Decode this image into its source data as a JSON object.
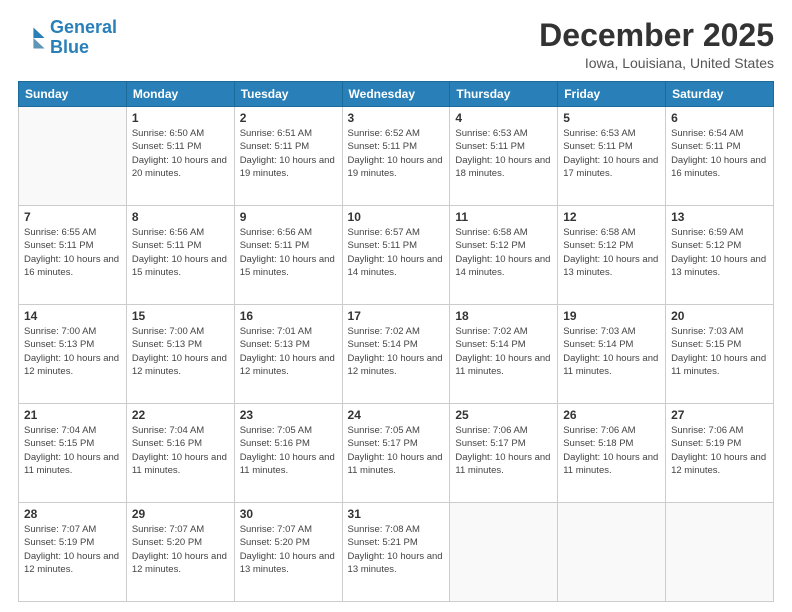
{
  "header": {
    "logo_line1": "General",
    "logo_line2": "Blue",
    "main_title": "December 2025",
    "subtitle": "Iowa, Louisiana, United States"
  },
  "calendar": {
    "weekdays": [
      "Sunday",
      "Monday",
      "Tuesday",
      "Wednesday",
      "Thursday",
      "Friday",
      "Saturday"
    ],
    "weeks": [
      [
        {
          "day": "",
          "empty": true
        },
        {
          "day": "1",
          "sunrise": "6:50 AM",
          "sunset": "5:11 PM",
          "daylight": "10 hours and 20 minutes."
        },
        {
          "day": "2",
          "sunrise": "6:51 AM",
          "sunset": "5:11 PM",
          "daylight": "10 hours and 19 minutes."
        },
        {
          "day": "3",
          "sunrise": "6:52 AM",
          "sunset": "5:11 PM",
          "daylight": "10 hours and 19 minutes."
        },
        {
          "day": "4",
          "sunrise": "6:53 AM",
          "sunset": "5:11 PM",
          "daylight": "10 hours and 18 minutes."
        },
        {
          "day": "5",
          "sunrise": "6:53 AM",
          "sunset": "5:11 PM",
          "daylight": "10 hours and 17 minutes."
        },
        {
          "day": "6",
          "sunrise": "6:54 AM",
          "sunset": "5:11 PM",
          "daylight": "10 hours and 16 minutes."
        }
      ],
      [
        {
          "day": "7",
          "sunrise": "6:55 AM",
          "sunset": "5:11 PM",
          "daylight": "10 hours and 16 minutes."
        },
        {
          "day": "8",
          "sunrise": "6:56 AM",
          "sunset": "5:11 PM",
          "daylight": "10 hours and 15 minutes."
        },
        {
          "day": "9",
          "sunrise": "6:56 AM",
          "sunset": "5:11 PM",
          "daylight": "10 hours and 15 minutes."
        },
        {
          "day": "10",
          "sunrise": "6:57 AM",
          "sunset": "5:11 PM",
          "daylight": "10 hours and 14 minutes."
        },
        {
          "day": "11",
          "sunrise": "6:58 AM",
          "sunset": "5:12 PM",
          "daylight": "10 hours and 14 minutes."
        },
        {
          "day": "12",
          "sunrise": "6:58 AM",
          "sunset": "5:12 PM",
          "daylight": "10 hours and 13 minutes."
        },
        {
          "day": "13",
          "sunrise": "6:59 AM",
          "sunset": "5:12 PM",
          "daylight": "10 hours and 13 minutes."
        }
      ],
      [
        {
          "day": "14",
          "sunrise": "7:00 AM",
          "sunset": "5:13 PM",
          "daylight": "10 hours and 12 minutes."
        },
        {
          "day": "15",
          "sunrise": "7:00 AM",
          "sunset": "5:13 PM",
          "daylight": "10 hours and 12 minutes."
        },
        {
          "day": "16",
          "sunrise": "7:01 AM",
          "sunset": "5:13 PM",
          "daylight": "10 hours and 12 minutes."
        },
        {
          "day": "17",
          "sunrise": "7:02 AM",
          "sunset": "5:14 PM",
          "daylight": "10 hours and 12 minutes."
        },
        {
          "day": "18",
          "sunrise": "7:02 AM",
          "sunset": "5:14 PM",
          "daylight": "10 hours and 11 minutes."
        },
        {
          "day": "19",
          "sunrise": "7:03 AM",
          "sunset": "5:14 PM",
          "daylight": "10 hours and 11 minutes."
        },
        {
          "day": "20",
          "sunrise": "7:03 AM",
          "sunset": "5:15 PM",
          "daylight": "10 hours and 11 minutes."
        }
      ],
      [
        {
          "day": "21",
          "sunrise": "7:04 AM",
          "sunset": "5:15 PM",
          "daylight": "10 hours and 11 minutes."
        },
        {
          "day": "22",
          "sunrise": "7:04 AM",
          "sunset": "5:16 PM",
          "daylight": "10 hours and 11 minutes."
        },
        {
          "day": "23",
          "sunrise": "7:05 AM",
          "sunset": "5:16 PM",
          "daylight": "10 hours and 11 minutes."
        },
        {
          "day": "24",
          "sunrise": "7:05 AM",
          "sunset": "5:17 PM",
          "daylight": "10 hours and 11 minutes."
        },
        {
          "day": "25",
          "sunrise": "7:06 AM",
          "sunset": "5:17 PM",
          "daylight": "10 hours and 11 minutes."
        },
        {
          "day": "26",
          "sunrise": "7:06 AM",
          "sunset": "5:18 PM",
          "daylight": "10 hours and 11 minutes."
        },
        {
          "day": "27",
          "sunrise": "7:06 AM",
          "sunset": "5:19 PM",
          "daylight": "10 hours and 12 minutes."
        }
      ],
      [
        {
          "day": "28",
          "sunrise": "7:07 AM",
          "sunset": "5:19 PM",
          "daylight": "10 hours and 12 minutes."
        },
        {
          "day": "29",
          "sunrise": "7:07 AM",
          "sunset": "5:20 PM",
          "daylight": "10 hours and 12 minutes."
        },
        {
          "day": "30",
          "sunrise": "7:07 AM",
          "sunset": "5:20 PM",
          "daylight": "10 hours and 13 minutes."
        },
        {
          "day": "31",
          "sunrise": "7:08 AM",
          "sunset": "5:21 PM",
          "daylight": "10 hours and 13 minutes."
        },
        {
          "day": "",
          "empty": true
        },
        {
          "day": "",
          "empty": true
        },
        {
          "day": "",
          "empty": true
        }
      ]
    ]
  }
}
